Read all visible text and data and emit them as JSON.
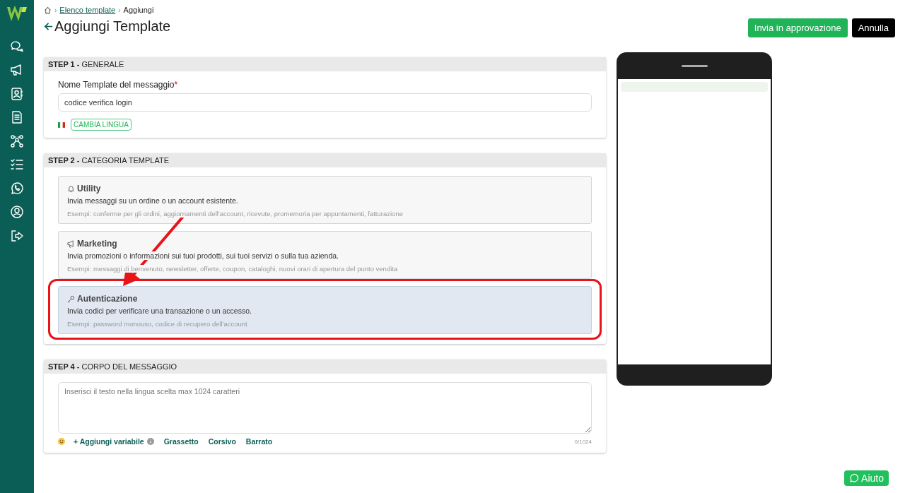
{
  "sidebar": {
    "items": [
      {
        "kind": "chat"
      },
      {
        "kind": "megaphone"
      },
      {
        "kind": "contacts"
      },
      {
        "kind": "document"
      },
      {
        "kind": "flow"
      },
      {
        "kind": "checklist"
      },
      {
        "kind": "whatsapp"
      },
      {
        "kind": "user"
      },
      {
        "kind": "logout"
      }
    ]
  },
  "breadcrumb": [
    {
      "separator": "›",
      "label": "Elenco template",
      "kind": "link"
    },
    {
      "separator": "›",
      "label": "Aggiungi",
      "kind": "current"
    }
  ],
  "title": "Aggiungi Template",
  "actions": [
    {
      "label": "Invia in approvazione",
      "kind": "primary"
    },
    {
      "label": "Annulla",
      "kind": "dark"
    }
  ],
  "step1": {
    "header": "**STEP 1 -** GENERALE",
    "label": "Nome Template del messaggio",
    "required_mark": "*",
    "value": "codice verifica login",
    "language_button": "CAMBIA LINGUA"
  },
  "step2": {
    "header": "**STEP 2 -** CATEGORIA TEMPLATE",
    "annotation_arrow": true,
    "outline_selected": true,
    "options": [
      {
        "kind": "utility",
        "title": "Utility",
        "description": "Invia messaggi su un ordine o un account esistente.",
        "examples": "Esempi: conferme per gli ordini, aggiornamenti dell'account, ricevute, promemoria per appuntamenti, fatturazione",
        "selected": false
      },
      {
        "kind": "marketing",
        "title": "Marketing",
        "description": "Invia promozioni o informazioni sui tuoi prodotti, sui tuoi servizi o sulla tua azienda.",
        "examples": "Esempi: messaggi di benvenuto, newsletter, offerte, coupon, cataloghi, nuovi orari di apertura del punto vendita",
        "selected": false
      },
      {
        "kind": "authentication",
        "title": "Autenticazione",
        "description": "Invia codici per verificare una transazione o un accesso.",
        "examples": "Esempi: password monouso, codice di recupero dell'account",
        "selected": true
      }
    ]
  },
  "step4": {
    "header": "**STEP 4 -** CORPO DEL MESSAGGIO",
    "placeholder": "Inserisci il testo nella lingua scelta max 1024 caratteri",
    "add_variable": "+ Aggiungi variabile",
    "formats": [
      "Grassetto",
      "Corsivo",
      "Barrato"
    ],
    "counter": "0/1024"
  },
  "help_button": "Aiuto"
}
